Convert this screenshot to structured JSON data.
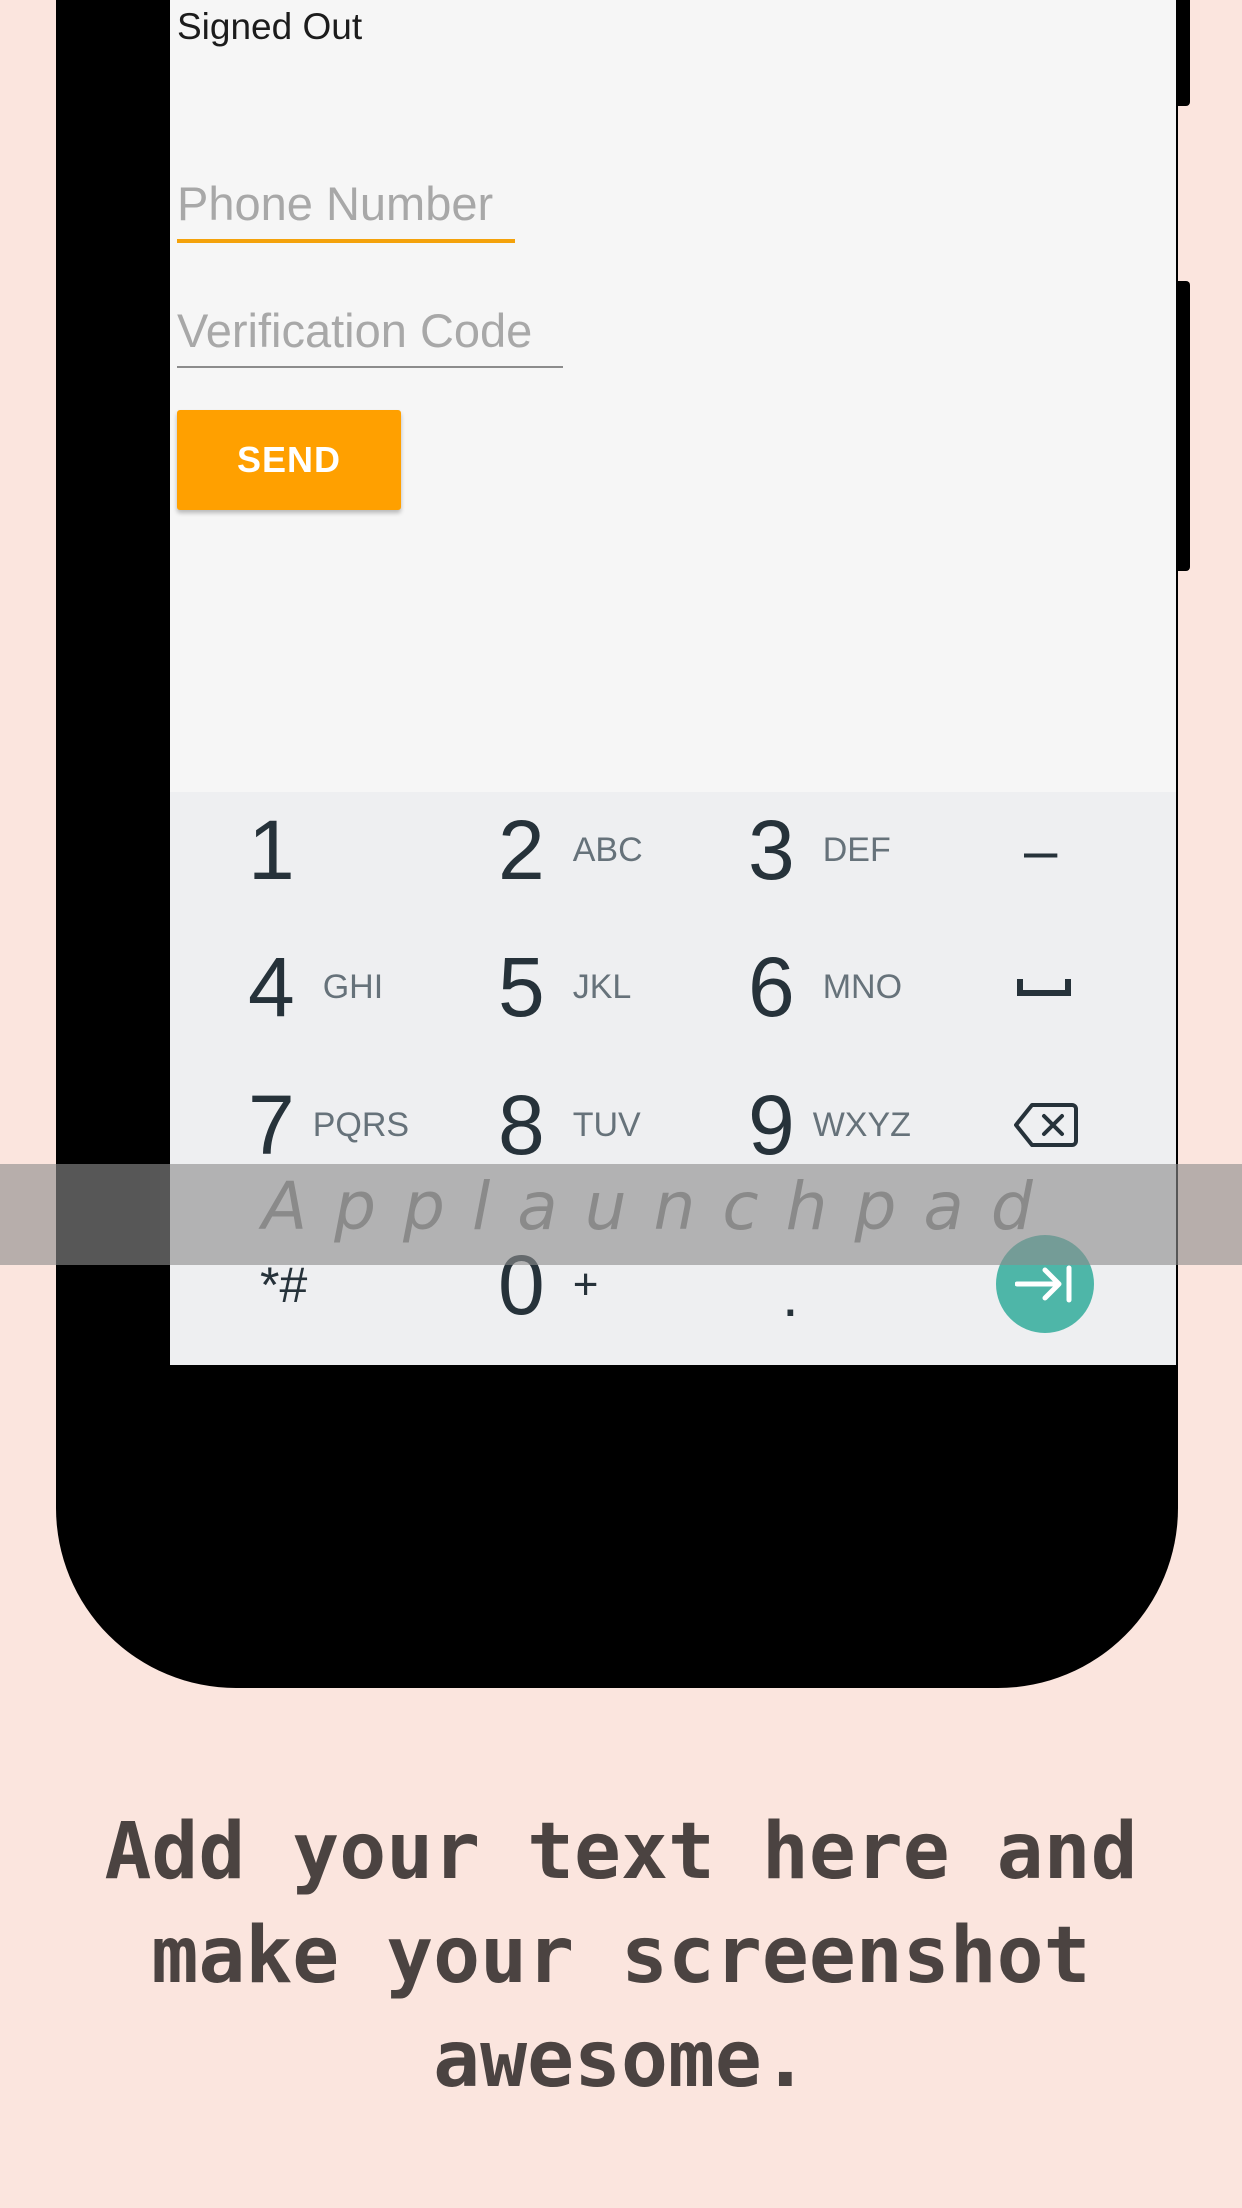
{
  "app": {
    "status": "Signed Out",
    "phone_placeholder": "Phone Number",
    "code_placeholder": "Verification Code",
    "send_label": "SEND"
  },
  "keyboard": {
    "keys": [
      {
        "digit": "1",
        "letters": ""
      },
      {
        "digit": "2",
        "letters": "ABC"
      },
      {
        "digit": "3",
        "letters": "DEF"
      },
      {
        "digit": "–",
        "letters": ""
      },
      {
        "digit": "4",
        "letters": "GHI"
      },
      {
        "digit": "5",
        "letters": "JKL"
      },
      {
        "digit": "6",
        "letters": "MNO"
      },
      {
        "digit": "7",
        "letters": "PQRS"
      },
      {
        "digit": "8",
        "letters": "TUV"
      },
      {
        "digit": "9",
        "letters": "WXYZ"
      },
      {
        "digit": "*#",
        "letters": ""
      },
      {
        "digit": "0",
        "letters": "+"
      },
      {
        "digit": ".",
        "letters": ""
      }
    ],
    "space_icon": "space-bar-icon",
    "backspace_icon": "backspace-icon",
    "enter_icon": "next-arrow-icon",
    "enter_color": "#4eb6a8"
  },
  "watermark": "Applaunchpad",
  "caption": {
    "line1": "Add your text here and",
    "line2": "make your screenshot",
    "line3": "awesome."
  },
  "colors": {
    "background": "#fbe5de",
    "accent": "#ffa000",
    "phone": "#000000"
  }
}
